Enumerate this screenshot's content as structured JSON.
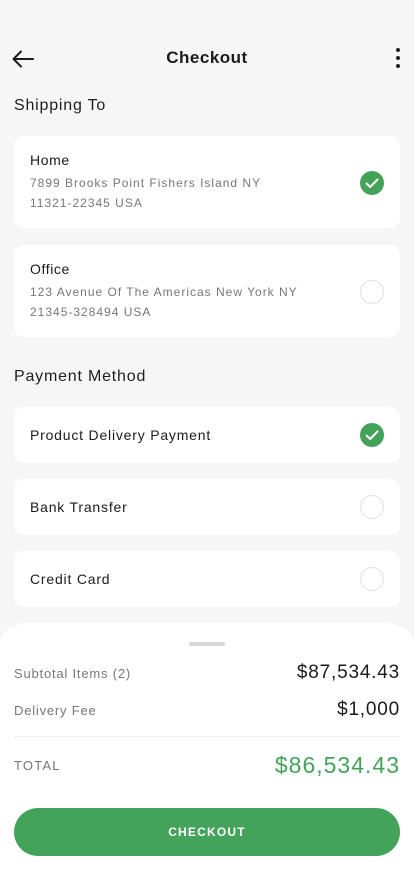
{
  "header": {
    "title": "Checkout"
  },
  "shipping": {
    "section_title": "Shipping To",
    "addresses": [
      {
        "name": "Home",
        "line1": "7899 Brooks Point Fishers Island NY",
        "line2": "11321-22345 USA",
        "selected": true
      },
      {
        "name": "Office",
        "line1": "123 Avenue Of The Americas New York NY",
        "line2": "21345-328494 USA",
        "selected": false
      }
    ]
  },
  "payment": {
    "section_title": "Payment Method",
    "methods": [
      {
        "label": "Product Delivery Payment",
        "selected": true
      },
      {
        "label": "Bank Transfer",
        "selected": false
      },
      {
        "label": "Credit Card",
        "selected": false
      }
    ]
  },
  "summary": {
    "subtotal_label": "Subtotal Items (2)",
    "subtotal_value": "$87,534.43",
    "delivery_label": "Delivery Fee",
    "delivery_value": "$1,000",
    "total_label": "TOTAL",
    "total_value": "$86,534.43",
    "checkout_label": "CHECKOUT"
  },
  "colors": {
    "accent": "#43a35a",
    "background": "#f6f6f6",
    "card": "#ffffff"
  },
  "icons": {
    "back": "arrow-left-icon",
    "more": "more-vertical-icon",
    "selected": "check-circle-icon",
    "unselected": "circle-outline-icon"
  }
}
